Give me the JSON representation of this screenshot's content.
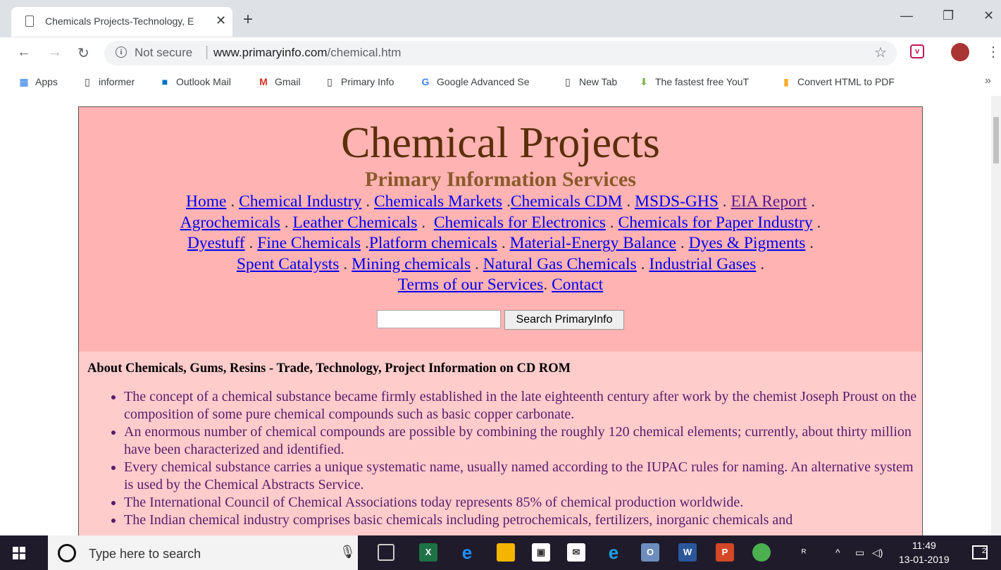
{
  "browser": {
    "tab_title": "Chemicals Projects-Technology, E",
    "tab_close": "✕",
    "new_tab": "+",
    "minimize": "—",
    "restore": "❐",
    "close": "✕",
    "back": "←",
    "forward": "→",
    "reload": "↻",
    "security": "Not secure",
    "url_domain": "www.primaryinfo.com",
    "url_path": "/chemical.htm",
    "star": "☆",
    "menu": "⋮"
  },
  "bookmarks": [
    {
      "label": "Apps",
      "icon": "apps-icon"
    },
    {
      "label": "informer",
      "icon": "page-icon"
    },
    {
      "label": "Outlook Mail",
      "icon": "outlook-icon"
    },
    {
      "label": "Gmail",
      "icon": "gmail-icon"
    },
    {
      "label": "Primary Info",
      "icon": "page-icon"
    },
    {
      "label": "Google Advanced Se",
      "icon": "google-icon"
    },
    {
      "label": "New Tab",
      "icon": "page-icon"
    },
    {
      "label": "The fastest free YouT",
      "icon": "download-icon"
    },
    {
      "label": "Convert HTML to PDF",
      "icon": "chart-icon"
    }
  ],
  "bookmarks_more": "»",
  "page": {
    "title": "Chemical Projects",
    "subtitle": "Primary Information Services",
    "nav": [
      "Home",
      "Chemical Industry",
      "Chemicals Markets",
      "Chemicals CDM",
      "MSDS-GHS",
      "EIA Report",
      "Agrochemicals",
      "Leather Chemicals",
      "Chemicals for Electronics",
      "Chemicals for Paper Industry",
      "Dyestuff",
      "Fine Chemicals",
      "Platform chemicals",
      "Material-Energy Balance",
      "Dyes & Pigments",
      "Spent Catalysts",
      "Mining chemicals",
      "Natural Gas Chemicals",
      "Industrial Gases",
      "Terms of our Services",
      "Contact"
    ],
    "search_button": "Search PrimaryInfo",
    "about_heading": "About Chemicals, Gums, Resins - Trade, Technology, Project Information on CD ROM",
    "bullets": [
      "The concept of a chemical substance became firmly established in the late eighteenth century after work by the chemist Joseph Proust on the composition of some pure chemical compounds such as basic copper carbonate.",
      "An enormous number of chemical compounds are possible by combining the roughly 120 chemical elements; currently, about thirty million have been characterized and identified.",
      "Every chemical substance carries a unique systematic name, usually named according to the IUPAC rules for naming. An alternative system is used by the Chemical Abstracts Service.",
      "The International Council of Chemical Associations today represents 85% of chemical production worldwide.",
      "The Indian chemical industry comprises basic chemicals including petrochemicals, fertilizers, inorganic chemicals and"
    ]
  },
  "taskbar": {
    "search_placeholder": "Type here to search",
    "time": "11:49",
    "date": "13-01-2019",
    "notifications": "2"
  }
}
